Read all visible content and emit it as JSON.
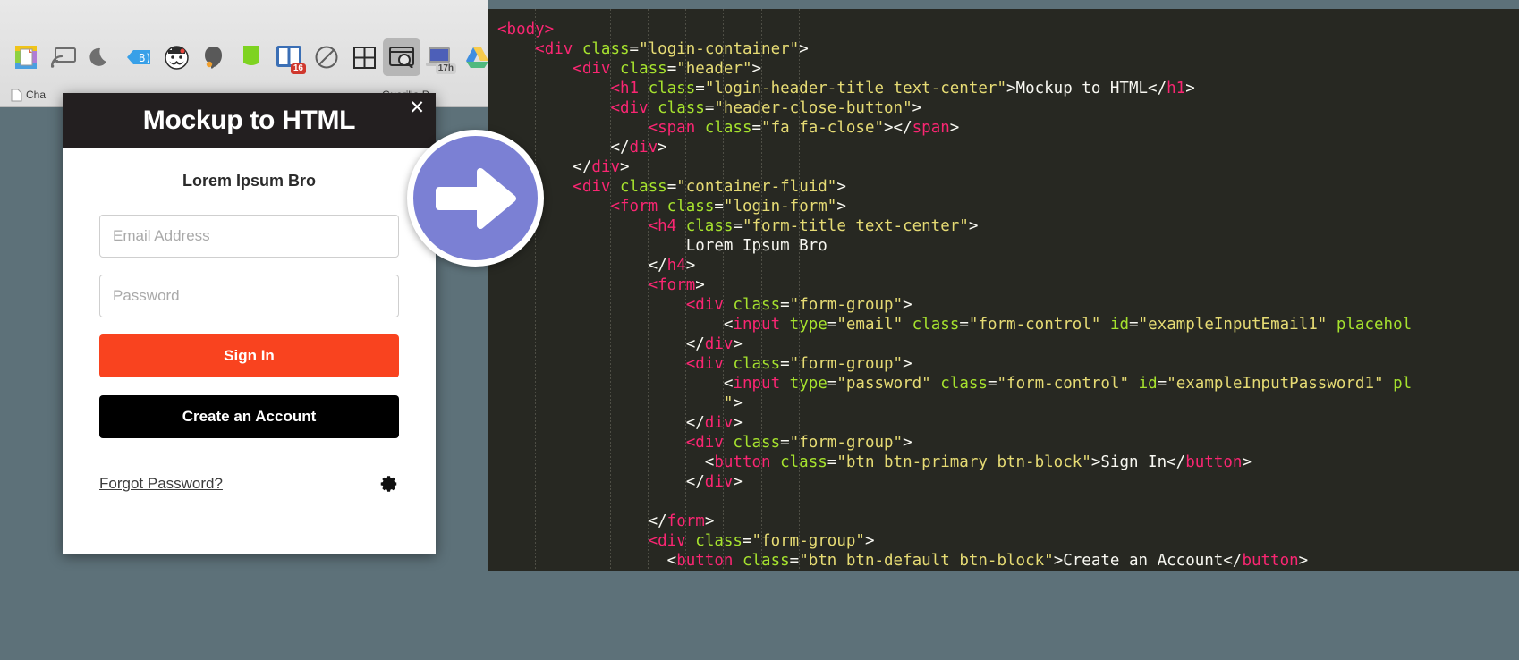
{
  "browser": {
    "extensions": [
      {
        "name": "evernote-clipper-icon",
        "label": ""
      },
      {
        "name": "screen-cast-icon",
        "label": ""
      },
      {
        "name": "night-mode-moon-icon",
        "label": ""
      },
      {
        "name": "bookmark-tag-icon",
        "label": ""
      },
      {
        "name": "mustache-avatar-icon",
        "label": ""
      },
      {
        "name": "evernote-elephant-icon",
        "label": ""
      },
      {
        "name": "green-flag-icon",
        "label": ""
      },
      {
        "name": "panels-icon",
        "badge": "16"
      },
      {
        "name": "slash-circle-icon",
        "label": ""
      },
      {
        "name": "grid-icon",
        "label": ""
      },
      {
        "name": "window-search-icon",
        "label": ""
      },
      {
        "name": "laptop-time-icon",
        "badge": "17h"
      },
      {
        "name": "google-drive-icon",
        "label": ""
      }
    ],
    "bookmarks": [
      {
        "label": "Cha"
      },
      {
        "label": "Guerilla P"
      }
    ]
  },
  "modal": {
    "title": "Mockup to HTML",
    "close_label": "✕",
    "form_title": "Lorem Ipsum Bro",
    "email_placeholder": "Email Address",
    "email_value": "",
    "password_placeholder": "Password",
    "password_value": "",
    "signin_label": "Sign In",
    "create_label": "Create an Account",
    "forgot_label": "Forgot Password?",
    "settings_icon": "gear-icon",
    "colors": {
      "header_bg": "#231f20",
      "primary_btn": "#f9431f",
      "default_btn": "#000000"
    }
  },
  "arrow_badge": {
    "icon": "arrow-right-icon",
    "color": "#7b80d4"
  },
  "editor": {
    "theme_bg": "#272822",
    "colors": {
      "tag": "#f92672",
      "attribute": "#a6e22e",
      "string": "#e6db74",
      "text": "#f8f8f2"
    },
    "lines": [
      [
        {
          "t": "tag",
          "s": "<body>"
        }
      ],
      [
        {
          "t": "txt",
          "s": "    "
        },
        {
          "t": "tag",
          "s": "<div"
        },
        {
          "t": "txt",
          "s": " "
        },
        {
          "t": "attr",
          "s": "class"
        },
        {
          "t": "punct",
          "s": "="
        },
        {
          "t": "val",
          "s": "\"login-container\""
        },
        {
          "t": "punct",
          "s": ">"
        }
      ],
      [
        {
          "t": "txt",
          "s": "        "
        },
        {
          "t": "tag",
          "s": "<div"
        },
        {
          "t": "txt",
          "s": " "
        },
        {
          "t": "attr",
          "s": "class"
        },
        {
          "t": "punct",
          "s": "="
        },
        {
          "t": "val",
          "s": "\"header\""
        },
        {
          "t": "punct",
          "s": ">"
        }
      ],
      [
        {
          "t": "txt",
          "s": "            "
        },
        {
          "t": "tag",
          "s": "<h1"
        },
        {
          "t": "txt",
          "s": " "
        },
        {
          "t": "attr",
          "s": "class"
        },
        {
          "t": "punct",
          "s": "="
        },
        {
          "t": "val",
          "s": "\"login-header-title text-center\""
        },
        {
          "t": "punct",
          "s": ">"
        },
        {
          "t": "txt",
          "s": "Mockup to HTML"
        },
        {
          "t": "punct",
          "s": "</"
        },
        {
          "t": "tag",
          "s": "h1"
        },
        {
          "t": "punct",
          "s": ">"
        }
      ],
      [
        {
          "t": "txt",
          "s": "            "
        },
        {
          "t": "tag",
          "s": "<div"
        },
        {
          "t": "txt",
          "s": " "
        },
        {
          "t": "attr",
          "s": "class"
        },
        {
          "t": "punct",
          "s": "="
        },
        {
          "t": "val",
          "s": "\"header-close-button\""
        },
        {
          "t": "punct",
          "s": ">"
        }
      ],
      [
        {
          "t": "txt",
          "s": "                "
        },
        {
          "t": "tag",
          "s": "<span"
        },
        {
          "t": "txt",
          "s": " "
        },
        {
          "t": "attr",
          "s": "class"
        },
        {
          "t": "punct",
          "s": "="
        },
        {
          "t": "val",
          "s": "\"fa fa-close\""
        },
        {
          "t": "punct",
          "s": "></"
        },
        {
          "t": "tag",
          "s": "span"
        },
        {
          "t": "punct",
          "s": ">"
        }
      ],
      [
        {
          "t": "txt",
          "s": "            "
        },
        {
          "t": "punct",
          "s": "</"
        },
        {
          "t": "tag",
          "s": "div"
        },
        {
          "t": "punct",
          "s": ">"
        }
      ],
      [
        {
          "t": "txt",
          "s": "        "
        },
        {
          "t": "punct",
          "s": "</"
        },
        {
          "t": "tag",
          "s": "div"
        },
        {
          "t": "punct",
          "s": ">"
        }
      ],
      [
        {
          "t": "txt",
          "s": "        "
        },
        {
          "t": "tag",
          "s": "<div"
        },
        {
          "t": "txt",
          "s": " "
        },
        {
          "t": "attr",
          "s": "class"
        },
        {
          "t": "punct",
          "s": "="
        },
        {
          "t": "val",
          "s": "\"container-fluid\""
        },
        {
          "t": "punct",
          "s": ">"
        }
      ],
      [
        {
          "t": "txt",
          "s": "            "
        },
        {
          "t": "tag",
          "s": "<form"
        },
        {
          "t": "txt",
          "s": " "
        },
        {
          "t": "attr",
          "s": "class"
        },
        {
          "t": "punct",
          "s": "="
        },
        {
          "t": "val",
          "s": "\"login-form\""
        },
        {
          "t": "punct",
          "s": ">"
        }
      ],
      [
        {
          "t": "txt",
          "s": "                "
        },
        {
          "t": "tag",
          "s": "<h4"
        },
        {
          "t": "txt",
          "s": " "
        },
        {
          "t": "attr",
          "s": "class"
        },
        {
          "t": "punct",
          "s": "="
        },
        {
          "t": "val",
          "s": "\"form-title text-center\""
        },
        {
          "t": "punct",
          "s": ">"
        }
      ],
      [
        {
          "t": "txt",
          "s": "                    Lorem Ipsum Bro"
        }
      ],
      [
        {
          "t": "txt",
          "s": "                "
        },
        {
          "t": "punct",
          "s": "</"
        },
        {
          "t": "tag",
          "s": "h4"
        },
        {
          "t": "punct",
          "s": ">"
        }
      ],
      [
        {
          "t": "txt",
          "s": "                "
        },
        {
          "t": "tag",
          "s": "<form"
        },
        {
          "t": "punct",
          "s": ">"
        }
      ],
      [
        {
          "t": "txt",
          "s": "                    "
        },
        {
          "t": "tag",
          "s": "<div"
        },
        {
          "t": "txt",
          "s": " "
        },
        {
          "t": "attr",
          "s": "class"
        },
        {
          "t": "punct",
          "s": "="
        },
        {
          "t": "val",
          "s": "\"form-group\""
        },
        {
          "t": "punct",
          "s": ">"
        }
      ],
      [
        {
          "t": "txt",
          "s": "                        "
        },
        {
          "t": "punct",
          "s": "<"
        },
        {
          "t": "tag",
          "s": "input"
        },
        {
          "t": "txt",
          "s": " "
        },
        {
          "t": "attr",
          "s": "type"
        },
        {
          "t": "punct",
          "s": "="
        },
        {
          "t": "val",
          "s": "\"email\""
        },
        {
          "t": "txt",
          "s": " "
        },
        {
          "t": "attr",
          "s": "class"
        },
        {
          "t": "punct",
          "s": "="
        },
        {
          "t": "val",
          "s": "\"form-control\""
        },
        {
          "t": "txt",
          "s": " "
        },
        {
          "t": "attr",
          "s": "id"
        },
        {
          "t": "punct",
          "s": "="
        },
        {
          "t": "val",
          "s": "\"exampleInputEmail1\""
        },
        {
          "t": "txt",
          "s": " "
        },
        {
          "t": "attr",
          "s": "placehol"
        }
      ],
      [
        {
          "t": "txt",
          "s": "                    "
        },
        {
          "t": "punct",
          "s": "</"
        },
        {
          "t": "tag",
          "s": "div"
        },
        {
          "t": "punct",
          "s": ">"
        }
      ],
      [
        {
          "t": "txt",
          "s": "                    "
        },
        {
          "t": "tag",
          "s": "<div"
        },
        {
          "t": "txt",
          "s": " "
        },
        {
          "t": "attr",
          "s": "class"
        },
        {
          "t": "punct",
          "s": "="
        },
        {
          "t": "val",
          "s": "\"form-group\""
        },
        {
          "t": "punct",
          "s": ">"
        }
      ],
      [
        {
          "t": "txt",
          "s": "                        "
        },
        {
          "t": "punct",
          "s": "<"
        },
        {
          "t": "tag",
          "s": "input"
        },
        {
          "t": "txt",
          "s": " "
        },
        {
          "t": "attr",
          "s": "type"
        },
        {
          "t": "punct",
          "s": "="
        },
        {
          "t": "val",
          "s": "\"password\""
        },
        {
          "t": "txt",
          "s": " "
        },
        {
          "t": "attr",
          "s": "class"
        },
        {
          "t": "punct",
          "s": "="
        },
        {
          "t": "val",
          "s": "\"form-control\""
        },
        {
          "t": "txt",
          "s": " "
        },
        {
          "t": "attr",
          "s": "id"
        },
        {
          "t": "punct",
          "s": "="
        },
        {
          "t": "val",
          "s": "\"exampleInputPassword1\""
        },
        {
          "t": "txt",
          "s": " "
        },
        {
          "t": "attr",
          "s": "pl"
        }
      ],
      [
        {
          "t": "txt",
          "s": "                        "
        },
        {
          "t": "val",
          "s": "\""
        },
        {
          "t": "punct",
          "s": ">"
        }
      ],
      [
        {
          "t": "txt",
          "s": "                    "
        },
        {
          "t": "punct",
          "s": "</"
        },
        {
          "t": "tag",
          "s": "div"
        },
        {
          "t": "punct",
          "s": ">"
        }
      ],
      [
        {
          "t": "txt",
          "s": "                    "
        },
        {
          "t": "tag",
          "s": "<div"
        },
        {
          "t": "txt",
          "s": " "
        },
        {
          "t": "attr",
          "s": "class"
        },
        {
          "t": "punct",
          "s": "="
        },
        {
          "t": "val",
          "s": "\"form-group\""
        },
        {
          "t": "punct",
          "s": ">"
        }
      ],
      [
        {
          "t": "txt",
          "s": "                      "
        },
        {
          "t": "punct",
          "s": "<"
        },
        {
          "t": "tag",
          "s": "button"
        },
        {
          "t": "txt",
          "s": " "
        },
        {
          "t": "attr",
          "s": "class"
        },
        {
          "t": "punct",
          "s": "="
        },
        {
          "t": "val",
          "s": "\"btn btn-primary btn-block\""
        },
        {
          "t": "punct",
          "s": ">"
        },
        {
          "t": "txt",
          "s": "Sign In"
        },
        {
          "t": "punct",
          "s": "</"
        },
        {
          "t": "tag",
          "s": "button"
        },
        {
          "t": "punct",
          "s": ">"
        }
      ],
      [
        {
          "t": "txt",
          "s": "                    "
        },
        {
          "t": "punct",
          "s": "</"
        },
        {
          "t": "tag",
          "s": "div"
        },
        {
          "t": "punct",
          "s": ">"
        }
      ],
      [
        {
          "t": "txt",
          "s": ""
        }
      ],
      [
        {
          "t": "txt",
          "s": "                "
        },
        {
          "t": "punct",
          "s": "</"
        },
        {
          "t": "tag",
          "s": "form"
        },
        {
          "t": "punct",
          "s": ">"
        }
      ],
      [
        {
          "t": "txt",
          "s": "                "
        },
        {
          "t": "tag",
          "s": "<div"
        },
        {
          "t": "txt",
          "s": " "
        },
        {
          "t": "attr",
          "s": "class"
        },
        {
          "t": "punct",
          "s": "="
        },
        {
          "t": "val",
          "s": "\"form-group\""
        },
        {
          "t": "punct",
          "s": ">"
        }
      ],
      [
        {
          "t": "txt",
          "s": "                  "
        },
        {
          "t": "punct",
          "s": "<"
        },
        {
          "t": "tag",
          "s": "button"
        },
        {
          "t": "txt",
          "s": " "
        },
        {
          "t": "attr",
          "s": "class"
        },
        {
          "t": "punct",
          "s": "="
        },
        {
          "t": "val",
          "s": "\"btn btn-default btn-block\""
        },
        {
          "t": "punct",
          "s": ">"
        },
        {
          "t": "txt",
          "s": "Create an Account"
        },
        {
          "t": "punct",
          "s": "</"
        },
        {
          "t": "tag",
          "s": "button"
        },
        {
          "t": "punct",
          "s": ">"
        }
      ]
    ]
  }
}
